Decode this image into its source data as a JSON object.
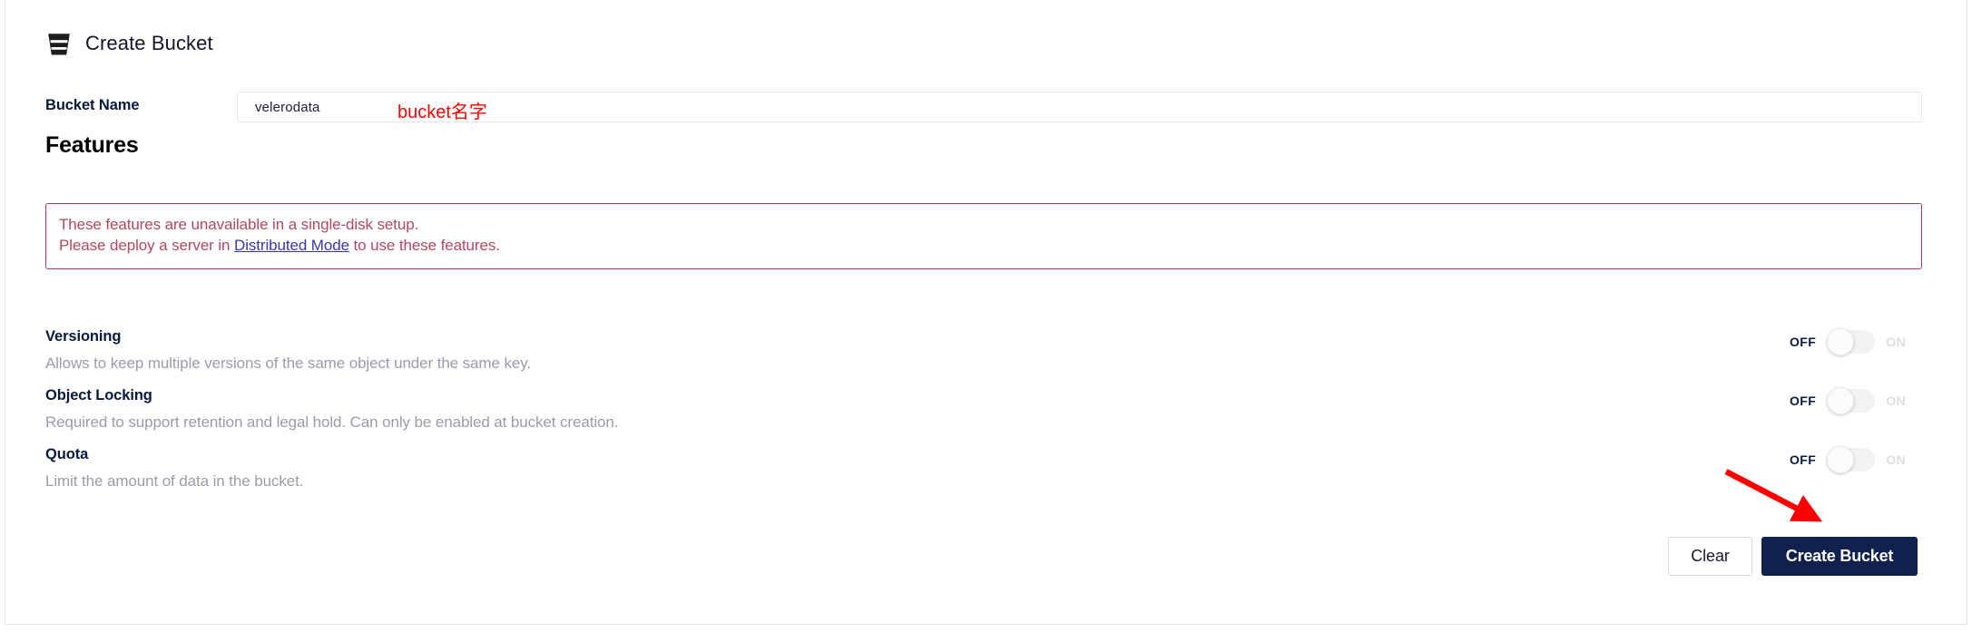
{
  "header": {
    "title": "Create Bucket",
    "icon": "bucket-icon"
  },
  "bucket_name_field": {
    "label": "Bucket Name",
    "value": "velerodata",
    "placeholder": "Bucket Name",
    "annotation": "bucket名字",
    "annotation_color": "#ff0000"
  },
  "features_section": {
    "heading": "Features",
    "warning": {
      "line1": "These features are unavailable in a single-disk setup.",
      "line2_before": "Please deploy a server in ",
      "link": "Distributed Mode",
      "line2_after": " to use these features.",
      "border_color": "#b23a56",
      "text_color": "#b2485f",
      "link_color": "#3a35b0"
    },
    "items": [
      {
        "title": "Versioning",
        "description": "Allows to keep multiple versions of the same object under the same key.",
        "toggle": {
          "off_label": "OFF",
          "on_label": "ON",
          "state": "off"
        }
      },
      {
        "title": "Object Locking",
        "description": "Required to support retention and legal hold. Can only be enabled at bucket creation.",
        "toggle": {
          "off_label": "OFF",
          "on_label": "ON",
          "state": "off"
        }
      },
      {
        "title": "Quota",
        "description": "Limit the amount of data in the bucket.",
        "toggle": {
          "off_label": "OFF",
          "on_label": "ON",
          "state": "off"
        }
      }
    ]
  },
  "actions": {
    "clear_label": "Clear",
    "create_label": "Create Bucket",
    "primary_color": "#10214e"
  },
  "annotations": {
    "arrow": {
      "name": "red-arrow-annotation",
      "color": "#ff0000",
      "points_to": "create-bucket-button"
    }
  }
}
